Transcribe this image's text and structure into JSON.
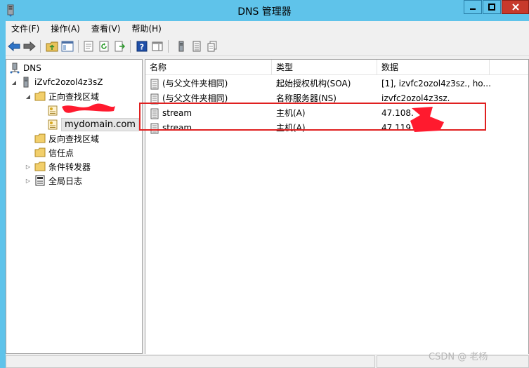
{
  "window": {
    "title": "DNS 管理器"
  },
  "menu": [
    "文件(F)",
    "操作(A)",
    "查看(V)",
    "帮助(H)"
  ],
  "tree": {
    "root": "DNS",
    "server": "iZvfc2ozol4z3sZ",
    "forward_zones": "正向查找区域",
    "zone_domain": "mydomain.com",
    "reverse_zones": "反向查找区域",
    "trust_points": "信任点",
    "conditional_forwarders": "条件转发器",
    "global_logs": "全局日志"
  },
  "list": {
    "columns": [
      "名称",
      "类型",
      "数据"
    ],
    "rows": [
      {
        "name": "(与父文件夹相同)",
        "type": "起始授权机构(SOA)",
        "data": "[1], izvfc2ozol4z3sz., ho..."
      },
      {
        "name": "(与父文件夹相同)",
        "type": "名称服务器(NS)",
        "data": "izvfc2ozol4z3sz."
      },
      {
        "name": "stream",
        "type": "主机(A)",
        "data": "47.108."
      },
      {
        "name": "stream",
        "type": "主机(A)",
        "data": "47.119."
      }
    ]
  },
  "watermark": "CSDN @ 老杨",
  "colors": {
    "title_bg": "#5fc3ea",
    "highlight": "#e02020",
    "redaction": "#ff1a2e"
  }
}
